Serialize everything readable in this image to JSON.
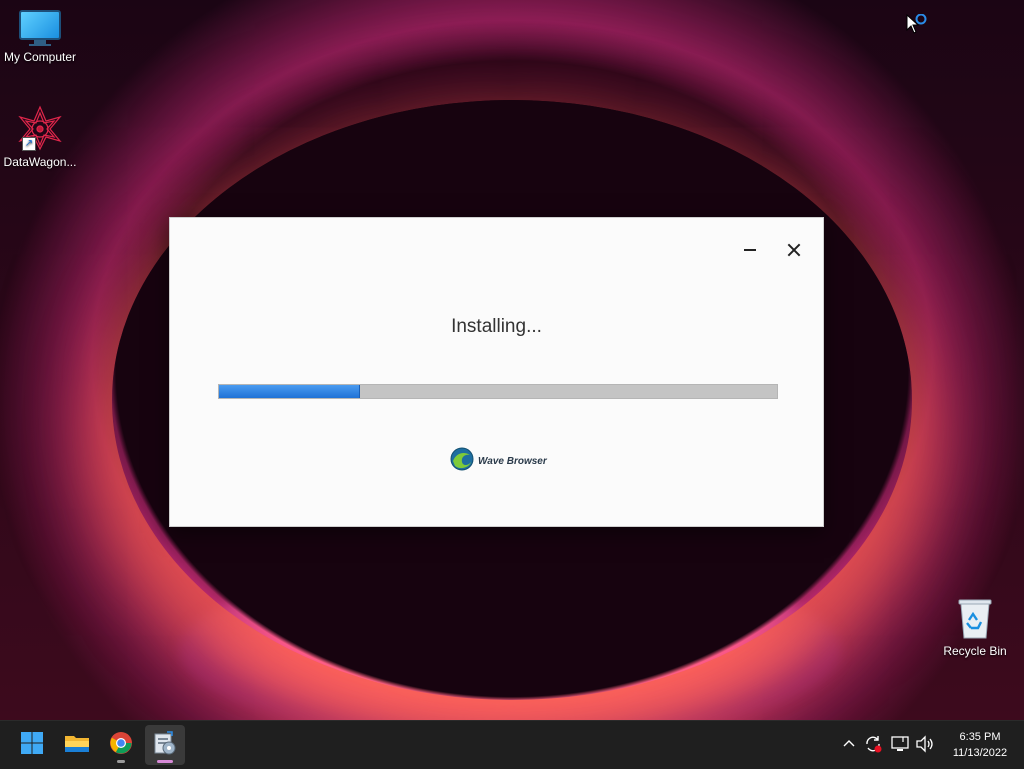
{
  "desktop": {
    "icons": [
      {
        "label": "My Computer",
        "icon": "monitor-icon"
      },
      {
        "label": "DataWagon...",
        "icon": "datawagon-app-icon"
      },
      {
        "label": "Recycle Bin",
        "icon": "recycle-bin-icon"
      }
    ]
  },
  "installer": {
    "status": "Installing...",
    "progress_fraction": 0.25,
    "brand_name": "Wave Browser",
    "controls": {
      "minimize": "minimize-icon",
      "close": "close-icon"
    }
  },
  "taskbar": {
    "apps": [
      {
        "name": "start",
        "icon": "windows-logo-icon"
      },
      {
        "name": "file-explorer",
        "icon": "folder-icon"
      },
      {
        "name": "chrome",
        "icon": "chrome-icon"
      },
      {
        "name": "installer",
        "icon": "installer-icon",
        "active": true
      }
    ],
    "tray": {
      "icons": [
        "chevron-up-icon",
        "sync-icon",
        "network-icon",
        "volume-icon"
      ],
      "time": "6:35 PM",
      "date": "11/13/2022"
    }
  },
  "colors": {
    "progress": "#1f72d6",
    "taskbar": "#1f1f1f",
    "active_indicator": "#d78ad8"
  }
}
